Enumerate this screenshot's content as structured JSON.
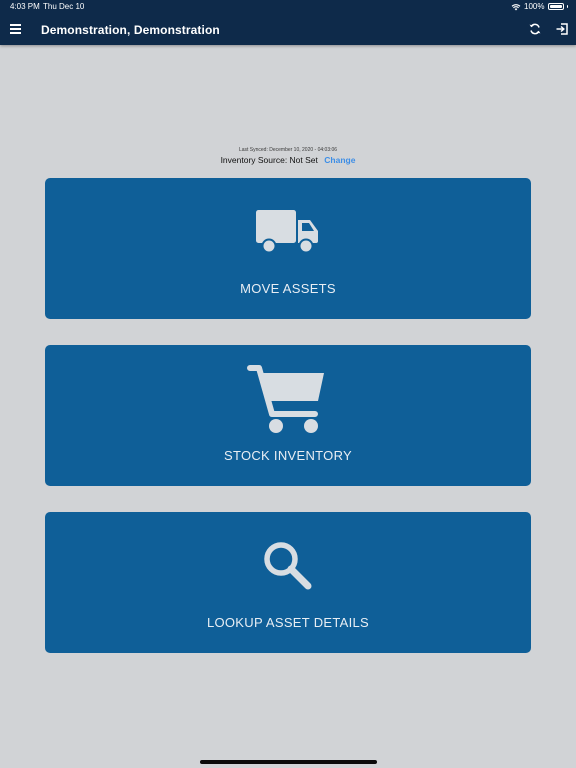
{
  "status_bar": {
    "time": "4:03 PM",
    "date": "Thu Dec 10",
    "battery": "100%",
    "wifi_icon": "wifi-icon",
    "battery_icon": "battery-icon"
  },
  "header": {
    "title": "Demonstration, Demonstration",
    "menu_icon": "hamburger-menu-icon",
    "sync_icon": "sync-icon",
    "logout_icon": "logout-icon",
    "background": "#0e2a4a"
  },
  "info": {
    "last_synced": "Last Synced: December 10, 2020 - 04:03:06",
    "inventory_source": "Inventory Source: Not Set",
    "change_label": "Change",
    "link_color": "#3d8ee6"
  },
  "tiles": [
    {
      "label": "MOVE ASSETS",
      "icon": "truck-icon"
    },
    {
      "label": "STOCK INVENTORY",
      "icon": "cart-icon"
    },
    {
      "label": "LOOKUP ASSET DETAILS",
      "icon": "magnifier-icon"
    }
  ],
  "colors": {
    "page_background": "#d1d3d6",
    "tile_background": "#0f5f98",
    "tile_icon": "#d8dde2"
  }
}
